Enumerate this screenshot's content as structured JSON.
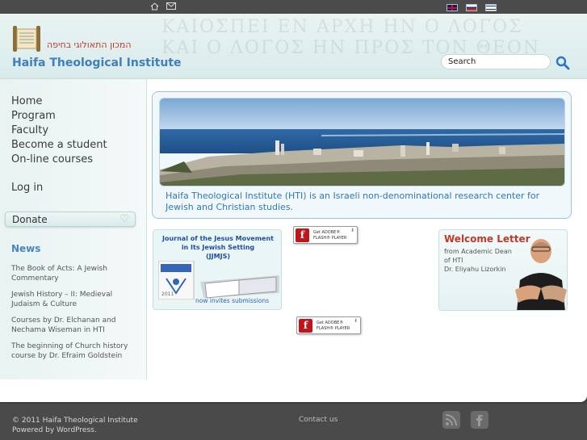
{
  "site": {
    "hebrew_name": "המכון התאולוגי בחיפה",
    "title": "Haifa Theological Institute",
    "bg_text": "ΚΑΙΟΣΠΕΙ ΕΝ ΑΡΧΗ ΗΝ Ο ΛΟΓΟΣ"
  },
  "topbar": {
    "icons": [
      "home-icon",
      "mail-icon"
    ],
    "languages": [
      "English",
      "Russian",
      "Hebrew"
    ]
  },
  "search": {
    "placeholder": "Search"
  },
  "nav": {
    "items": [
      "Home",
      "Program",
      "Faculty",
      "Become a student",
      "On-line courses"
    ],
    "login": "Log in",
    "donate": "Donate"
  },
  "news": {
    "title": "News",
    "items": [
      "The Book of Acts: A Jewish Commentary",
      "Jewish History – II: Medieval Judaism & Culture",
      "Courses by Dr. Elchanan and Nechama Wiseman in HTI",
      "The beginning of Church history course by Dr. Efraim Goldstein"
    ]
  },
  "banner": {
    "caption": "Haifa Theological Institute (HTI) is an Israeli non-denominational research center for Jewish and Christian studies."
  },
  "journal": {
    "title_line1": "Journal of the Jesus Movement",
    "title_line2": "in Its Jewish Setting",
    "title_line3": "(JJMJS)",
    "footer": "now invites submissions",
    "year": "2011"
  },
  "flash": {
    "line1": "Get ADOBE®",
    "line2": "FLASH® PLAYER"
  },
  "welcome": {
    "title": "Welcome Letter",
    "line1": "from Academic Dean",
    "line2": "of HTI",
    "line3": "Dr. Eliyahu Lizorkin"
  },
  "footer": {
    "copyright": "© 2011 Haifa Theological Institute",
    "powered_prefix": "Powered by ",
    "powered_link": "WordPress",
    "powered_suffix": ".",
    "contact": "Contact us",
    "social": [
      "rss-icon",
      "facebook-icon"
    ]
  },
  "colors": {
    "accent_blue": "#3f7fbf",
    "welcome_red": "#c0392b",
    "footer_bg": "#4a4a4a"
  }
}
